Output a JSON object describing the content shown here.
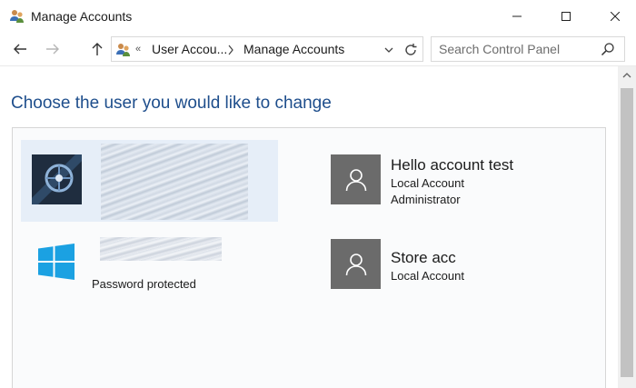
{
  "window": {
    "title": "Manage Accounts"
  },
  "address": {
    "crumb1": "User Accou...",
    "crumb2": "Manage Accounts"
  },
  "search": {
    "placeholder": "Search Control Panel"
  },
  "content": {
    "heading": "Choose the user you would like to change",
    "accounts": [
      {
        "line": "Password protected"
      },
      {
        "name": "Hello account test",
        "lines": [
          "Local Account",
          "Administrator"
        ]
      },
      {
        "name": "Store acc",
        "lines": [
          "Local Account"
        ]
      }
    ]
  },
  "colors": {
    "heading": "#1e4e8c",
    "selection": "#e6eef8",
    "tile": "#6b6b6b",
    "windows_logo": "#1ba1e2"
  }
}
